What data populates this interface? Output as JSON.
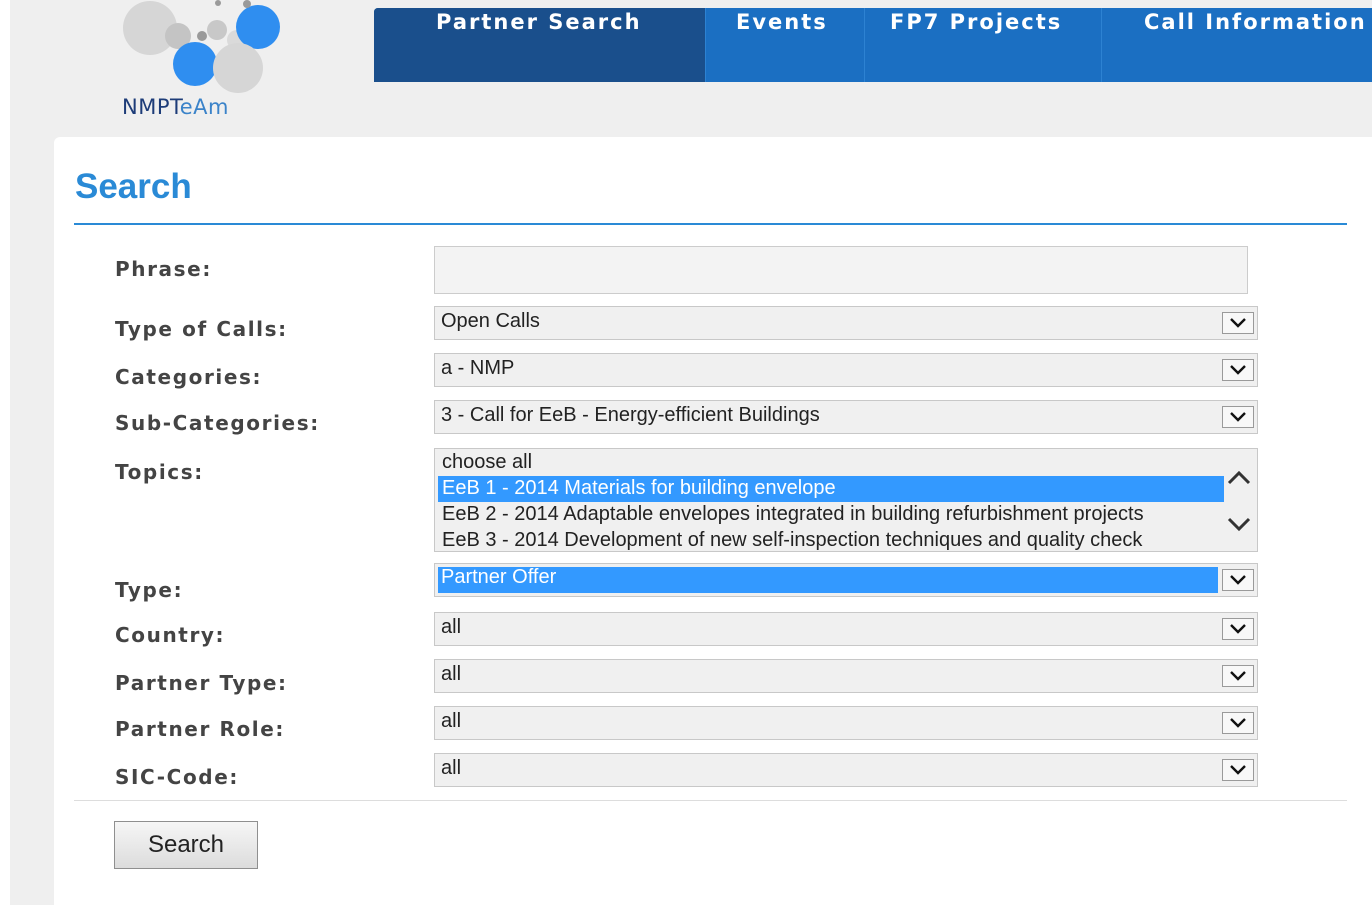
{
  "brand": {
    "logo_text_dark": "NMPT",
    "logo_text_light": "eAm"
  },
  "nav": {
    "items": [
      {
        "label": "Partner Search",
        "active": true
      },
      {
        "label": "Events",
        "active": false
      },
      {
        "label": "FP7 Projects",
        "active": false
      },
      {
        "label": "Call Information",
        "active": false
      }
    ]
  },
  "page": {
    "title": "Search"
  },
  "form": {
    "phrase": {
      "label": "Phrase:",
      "value": ""
    },
    "type_of_calls": {
      "label": "Type of Calls:",
      "value": "Open Calls"
    },
    "categories": {
      "label": "Categories:",
      "value": "a - NMP"
    },
    "sub_categories": {
      "label": "Sub-Categories:",
      "value": "3 - Call for EeB - Energy-efficient Buildings"
    },
    "topics": {
      "label": "Topics:",
      "options": [
        "choose all",
        "EeB 1 - 2014 Materials for building envelope",
        "EeB 2 - 2014 Adaptable envelopes integrated in building refurbishment projects",
        "EeB 3 - 2014 Development of new self-inspection techniques and quality check"
      ],
      "selected": "EeB 1 - 2014 Materials for building envelope"
    },
    "type": {
      "label": "Type:",
      "value": "Partner Offer"
    },
    "country": {
      "label": "Country:",
      "value": "all"
    },
    "partner_type": {
      "label": "Partner Type:",
      "value": "all"
    },
    "partner_role": {
      "label": "Partner Role:",
      "value": "all"
    },
    "sic_code": {
      "label": "SIC-Code:",
      "value": "all"
    },
    "submit_label": "Search"
  },
  "colors": {
    "nav_bg": "#1b6fc2",
    "nav_active": "#1a4f8c",
    "accent": "#2a8ad6",
    "selection": "#3399ff"
  },
  "icons": {
    "dropdown": "chevron-down-icon",
    "scroll_up": "chevron-up-icon",
    "scroll_down": "chevron-down-icon",
    "logo": "circles-logo"
  }
}
